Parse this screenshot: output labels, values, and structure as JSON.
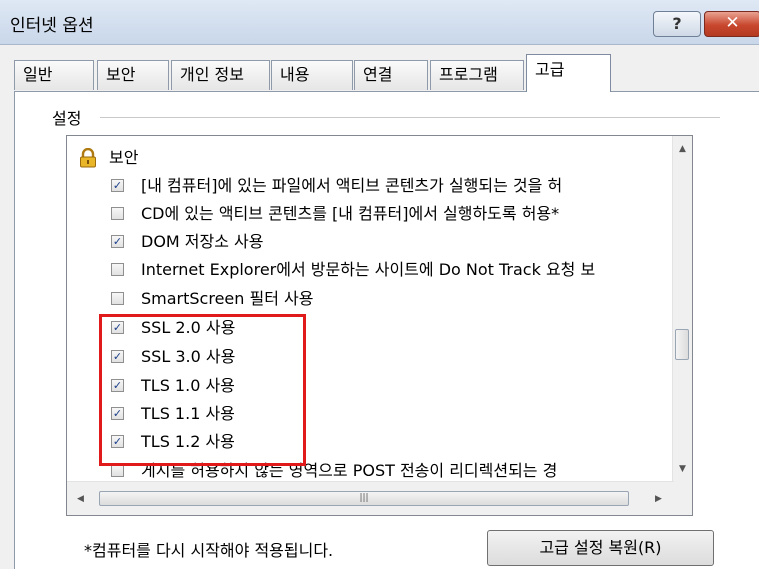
{
  "window": {
    "title": "인터넷 옵션",
    "help_label": "?",
    "close_label": "✕"
  },
  "tabs": [
    {
      "label": "일반"
    },
    {
      "label": "보안"
    },
    {
      "label": "개인 정보"
    },
    {
      "label": "내용"
    },
    {
      "label": "연결"
    },
    {
      "label": "프로그램"
    },
    {
      "label": "고급",
      "active": true
    }
  ],
  "settings": {
    "group_label": "설정",
    "category": {
      "label": "보안",
      "icon": "lock-icon"
    },
    "items": [
      {
        "label": "[내 컴퓨터]에 있는 파일에서 액티브 콘텐츠가 실행되는 것을 허",
        "checked": true
      },
      {
        "label": "CD에 있는 액티브 콘텐츠를 [내 컴퓨터]에서 실행하도록 허용*",
        "checked": false
      },
      {
        "label": "DOM 저장소 사용",
        "checked": true
      },
      {
        "label": "Internet Explorer에서 방문하는 사이트에 Do Not Track 요청 보",
        "checked": false
      },
      {
        "label": "SmartScreen 필터 사용",
        "checked": false
      },
      {
        "label": "SSL 2.0 사용",
        "checked": true
      },
      {
        "label": "SSL 3.0 사용",
        "checked": true
      },
      {
        "label": "TLS 1.0 사용",
        "checked": true
      },
      {
        "label": "TLS 1.1 사용",
        "checked": true
      },
      {
        "label": "TLS 1.2 사용",
        "checked": true
      },
      {
        "label": "게시를 허용하지 않는 영역으로 POST 전송이 리디렉션되는 경",
        "checked": false
      }
    ]
  },
  "footer": {
    "note": "*컴퓨터를 다시 시작해야 적용됩니다.",
    "reset_button": "고급 설정 복원(R)"
  },
  "colors": {
    "highlight_border": "#e0191a",
    "title_bar": "#dfe8f4",
    "close_button": "#c8472e"
  }
}
